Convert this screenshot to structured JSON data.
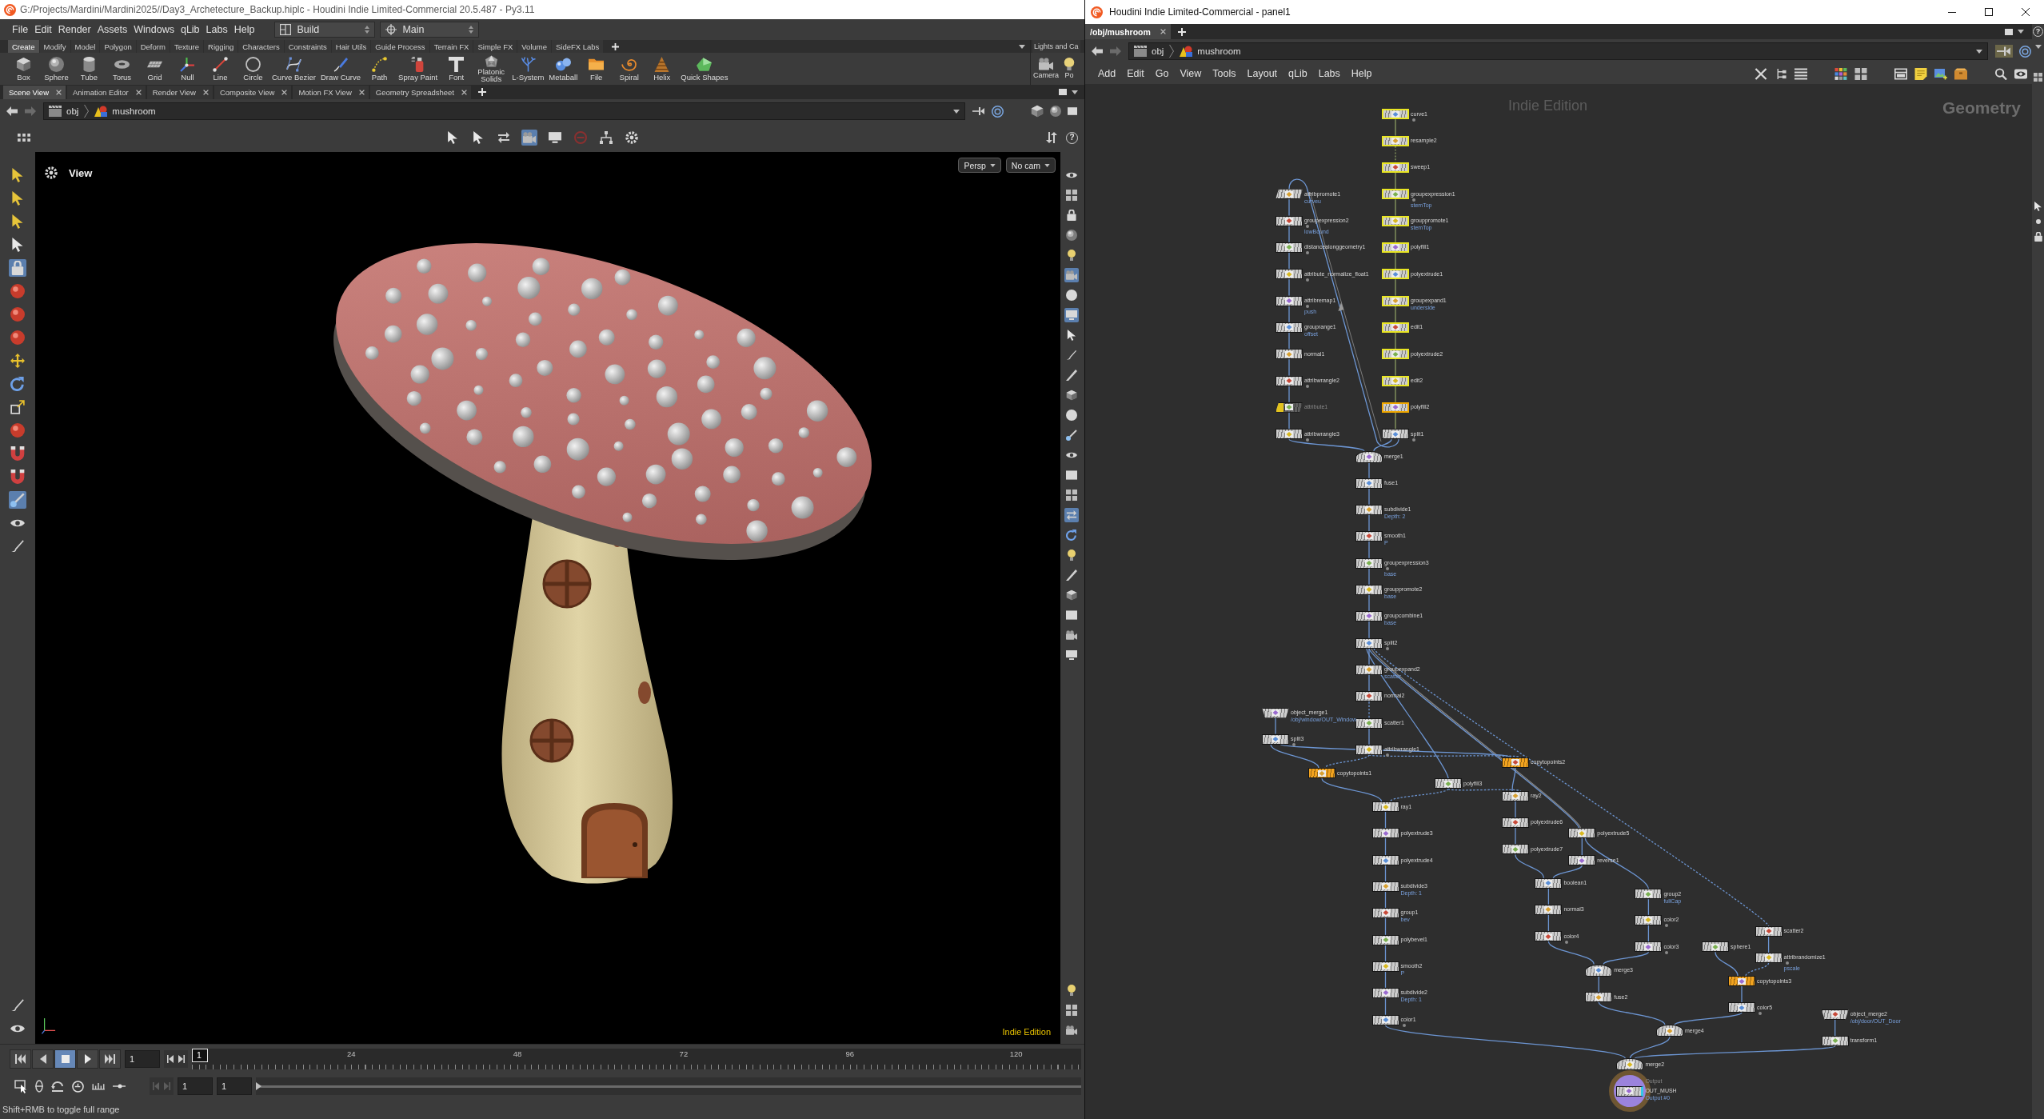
{
  "main_window": {
    "title": "G:/Projects/Mardini/Mardini2025//Day3_Archetecture_Backup.hiplc - Houdini Indie Limited-Commercial 20.5.487 - Py3.11",
    "menu": [
      "File",
      "Edit",
      "Render",
      "Assets",
      "Windows",
      "qLib",
      "Labs",
      "Help"
    ],
    "desktop": "Build",
    "workspace": "Main",
    "shelf_tabs": [
      {
        "label": "Create",
        "selected": true
      },
      {
        "label": "Modify",
        "selected": false
      },
      {
        "label": "Model",
        "selected": false
      },
      {
        "label": "Polygon",
        "selected": false
      },
      {
        "label": "Deform",
        "selected": false
      },
      {
        "label": "Texture",
        "selected": false
      },
      {
        "label": "Rigging",
        "selected": false
      },
      {
        "label": "Characters",
        "selected": false
      },
      {
        "label": "Constraints",
        "selected": false
      },
      {
        "label": "Hair Utils",
        "selected": false
      },
      {
        "label": "Guide Process",
        "selected": false
      },
      {
        "label": "Terrain FX",
        "selected": false
      },
      {
        "label": "Simple FX",
        "selected": false
      },
      {
        "label": "Volume",
        "selected": false
      },
      {
        "label": "SideFX Labs",
        "selected": false
      }
    ],
    "shelf_tools": [
      "Box",
      "Sphere",
      "Tube",
      "Torus",
      "Grid",
      "Null",
      "Line",
      "Circle",
      "Curve Bezier",
      "Draw Curve",
      "Path",
      "Spray Paint",
      "Font",
      "Platonic Solids",
      "L-System",
      "Metaball",
      "File",
      "Spiral",
      "Helix",
      "Quick Shapes"
    ],
    "side_shelf": {
      "tab": "Lights and Ca",
      "tools": [
        "Camera",
        "Po"
      ]
    },
    "pane_tabs": [
      {
        "label": "Scene View",
        "selected": true
      },
      {
        "label": "Animation Editor",
        "selected": false
      },
      {
        "label": "Render View",
        "selected": false
      },
      {
        "label": "Composite View",
        "selected": false
      },
      {
        "label": "Motion FX View",
        "selected": false
      },
      {
        "label": "Geometry Spreadsheet",
        "selected": false
      }
    ],
    "path": [
      "obj",
      "mushroom"
    ],
    "view_tools": [
      {
        "selected": false
      },
      {
        "selected": false
      },
      {
        "selected": false
      },
      {
        "selected": true
      },
      {
        "selected": false
      },
      {
        "selected": false
      },
      {
        "selected": false
      },
      {
        "selected": false
      }
    ],
    "view_help": "?",
    "left_tools": [
      {
        "selected": false
      },
      {
        "selected": false
      },
      {
        "selected": false
      },
      {
        "selected": false
      },
      {
        "selected": true
      },
      {
        "selected": false
      },
      {
        "selected": false
      },
      {
        "selected": false
      },
      {
        "selected": false
      },
      {
        "selected": false
      },
      {
        "selected": false
      },
      {
        "selected": false
      },
      {
        "selected": false
      },
      {
        "selected": false
      },
      {
        "selected": true
      },
      {
        "selected": false
      },
      {
        "selected": false
      },
      {
        "selected": false
      },
      {
        "selected": false
      }
    ],
    "viewport": {
      "title": "View",
      "menus": [
        "Persp",
        "No cam"
      ],
      "watermark": "Indie Edition"
    },
    "right_tools": [
      {
        "selected": false
      },
      {
        "selected": false
      },
      {
        "selected": false
      },
      {
        "selected": false
      },
      {
        "selected": false
      },
      {
        "selected": true
      },
      {
        "selected": false
      },
      {
        "selected": true
      },
      {
        "selected": false
      },
      {
        "selected": false
      },
      {
        "selected": false
      },
      {
        "selected": false
      },
      {
        "selected": false
      },
      {
        "selected": false
      },
      {
        "selected": false
      },
      {
        "selected": false
      },
      {
        "selected": false
      },
      {
        "selected": true
      },
      {
        "selected": false
      },
      {
        "selected": false
      },
      {
        "selected": false
      },
      {
        "selected": false
      },
      {
        "selected": false
      },
      {
        "selected": false
      },
      {
        "selected": false
      },
      {
        "selected": false
      },
      {
        "selected": false
      },
      {
        "selected": false
      }
    ],
    "timeline": {
      "playback": [
        {
          "selected": false
        },
        {
          "selected": false
        },
        {
          "selected": true
        },
        {
          "selected": false
        },
        {
          "selected": false
        }
      ],
      "frame": "1",
      "marker": "1",
      "ticks": [
        "24",
        "48",
        "72",
        "96",
        "120"
      ],
      "range_start": "1",
      "range_end": "1",
      "range_bar": {
        "level": 1
      }
    },
    "status_bar": "Shift+RMB to toggle full range"
  },
  "network_window": {
    "title": "Houdini Indie Limited-Commercial - panel1",
    "tabs": [
      {
        "label": "/obj/mushroom",
        "selected": true
      }
    ],
    "help": "?",
    "path": [
      "obj",
      "mushroom"
    ],
    "menu": [
      "Add",
      "Edit",
      "Go",
      "View",
      "Tools",
      "Layout",
      "qLib",
      "Labs",
      "Help"
    ],
    "watermark": "Indie Edition",
    "context": "Geometry",
    "nodes": [
      {
        "name": "curve1",
        "kind": "sop",
        "color": "#cccccc",
        "selected": true,
        "current": false,
        "bypassed": false,
        "dot": true
      },
      {
        "name": "resample2",
        "kind": "sop",
        "color": "#cccccc",
        "selected": true,
        "current": false,
        "bypassed": false,
        "dot": false
      },
      {
        "name": "sweep1",
        "kind": "sop",
        "color": "#cccccc",
        "selected": true,
        "current": false,
        "bypassed": false,
        "dot": false
      },
      {
        "name": "groupexpression1",
        "kind": "sop",
        "color": "#cccccc",
        "selected": true,
        "current": false,
        "bypassed": false,
        "dot": true,
        "note": "stemTop"
      },
      {
        "name": "grouppromote1",
        "kind": "sop",
        "color": "#cccccc",
        "selected": true,
        "current": false,
        "bypassed": false,
        "dot": false,
        "note": "stemTop"
      },
      {
        "name": "polyfill1",
        "kind": "sop",
        "color": "#cccccc",
        "selected": true,
        "current": false,
        "bypassed": false,
        "dot": false
      },
      {
        "name": "polyextrude1",
        "kind": "sop",
        "color": "#cccccc",
        "selected": true,
        "current": false,
        "bypassed": false,
        "dot": false
      },
      {
        "name": "groupexpand1",
        "kind": "sop",
        "color": "#cccccc",
        "selected": true,
        "current": false,
        "bypassed": false,
        "dot": false,
        "note": "underside"
      },
      {
        "name": "edit1",
        "kind": "sop",
        "color": "#cccccc",
        "selected": true,
        "current": false,
        "bypassed": false,
        "dot": false
      },
      {
        "name": "polyextrude2",
        "kind": "sop",
        "color": "#cccccc",
        "selected": true,
        "current": false,
        "bypassed": false,
        "dot": false
      },
      {
        "name": "edit2",
        "kind": "sop",
        "color": "#cccccc",
        "selected": true,
        "current": false,
        "bypassed": false,
        "dot": false
      },
      {
        "name": "polyfill2",
        "kind": "sop",
        "color": "#cccccc",
        "selected": true,
        "current": true,
        "bypassed": false,
        "dot": false
      },
      {
        "name": "split1",
        "kind": "sop",
        "color": "#cccccc",
        "selected": false,
        "current": false,
        "bypassed": false,
        "dot": true
      },
      {
        "name": "attribpromote1",
        "kind": "slanted",
        "color": "#cccccc",
        "selected": false,
        "current": false,
        "bypassed": false,
        "dot": false,
        "note": "curveu"
      },
      {
        "name": "groupexpression2",
        "kind": "sop",
        "color": "#cccccc",
        "selected": false,
        "current": false,
        "bypassed": false,
        "dot": true,
        "note": "lowBound"
      },
      {
        "name": "distancealonggeometry1",
        "kind": "sop",
        "color": "#cccccc",
        "selected": false,
        "current": false,
        "bypassed": false,
        "dot": true
      },
      {
        "name": "attribute_normalize_float1",
        "kind": "sop",
        "color": "#cccccc",
        "selected": false,
        "current": false,
        "bypassed": false,
        "dot": true
      },
      {
        "name": "attribremap1",
        "kind": "sop",
        "color": "#cccccc",
        "selected": false,
        "current": false,
        "bypassed": false,
        "dot": true,
        "note": "push"
      },
      {
        "name": "grouprange1",
        "kind": "sop",
        "color": "#cccccc",
        "selected": false,
        "current": false,
        "bypassed": false,
        "dot": false,
        "note": "offset"
      },
      {
        "name": "normal1",
        "kind": "sop",
        "color": "#cccccc",
        "selected": false,
        "current": false,
        "bypassed": false,
        "dot": false
      },
      {
        "name": "attribwrangle2",
        "kind": "sop",
        "color": "#cccccc",
        "selected": false,
        "current": false,
        "bypassed": false,
        "dot": true
      },
      {
        "name": "attribute1",
        "kind": "slanted",
        "color": "#5e5e5e",
        "selected": false,
        "current": false,
        "bypassed": true,
        "dot": false
      },
      {
        "name": "attribwrangle3",
        "kind": "sop",
        "color": "#cccccc",
        "selected": false,
        "current": false,
        "bypassed": false,
        "dot": true
      },
      {
        "name": "merge1",
        "kind": "merge",
        "color": "#cccccc",
        "selected": false,
        "current": false,
        "bypassed": false,
        "dot": false
      },
      {
        "name": "fuse1",
        "kind": "sop",
        "color": "#cccccc",
        "selected": false,
        "current": false,
        "bypassed": false,
        "dot": false
      },
      {
        "name": "subdivide1",
        "kind": "sop",
        "color": "#cccccc",
        "selected": false,
        "current": false,
        "bypassed": false,
        "dot": false,
        "note": "Depth: 2"
      },
      {
        "name": "smooth1",
        "kind": "sop",
        "color": "#cccccc",
        "selected": false,
        "current": false,
        "bypassed": false,
        "dot": false,
        "note": "P"
      },
      {
        "name": "groupexpression3",
        "kind": "sop",
        "color": "#cccccc",
        "selected": false,
        "current": false,
        "bypassed": false,
        "dot": true,
        "note": "base"
      },
      {
        "name": "grouppromote2",
        "kind": "sop",
        "color": "#cccccc",
        "selected": false,
        "current": false,
        "bypassed": false,
        "dot": false,
        "note": "base"
      },
      {
        "name": "groupcombine1",
        "kind": "sop",
        "color": "#cccccc",
        "selected": false,
        "current": false,
        "bypassed": false,
        "dot": false,
        "note": "base"
      },
      {
        "name": "split2",
        "kind": "sop",
        "color": "#cccccc",
        "selected": false,
        "current": false,
        "bypassed": false,
        "dot": true
      },
      {
        "name": "groupexpand2",
        "kind": "sop",
        "color": "#cccccc",
        "selected": false,
        "current": false,
        "bypassed": false,
        "dot": false,
        "note": "scatter"
      },
      {
        "name": "normal2",
        "kind": "sop",
        "color": "#cccccc",
        "selected": false,
        "current": false,
        "bypassed": false,
        "dot": false
      },
      {
        "name": "scatter1",
        "kind": "sop",
        "color": "#cccccc",
        "selected": false,
        "current": false,
        "bypassed": false,
        "dot": false
      },
      {
        "name": "attribwrangle1",
        "kind": "sop",
        "color": "#cccccc",
        "selected": false,
        "current": false,
        "bypassed": false,
        "dot": true
      },
      {
        "name": "object_merge1",
        "kind": "object_merge",
        "color": "#cccccc",
        "selected": false,
        "current": false,
        "bypassed": false,
        "dot": false,
        "note": "/obj/window/OUT_Window"
      },
      {
        "name": "split3",
        "kind": "sop",
        "color": "#cccccc",
        "selected": false,
        "current": false,
        "bypassed": false,
        "dot": true
      },
      {
        "name": "copytopoints1",
        "kind": "sop",
        "color": "#f2a31f",
        "selected": false,
        "current": false,
        "bypassed": false,
        "dot": false
      },
      {
        "name": "copytopoints2",
        "kind": "sop",
        "color": "#f2a31f",
        "selected": false,
        "current": false,
        "bypassed": false,
        "dot": false
      },
      {
        "name": "polyfill3",
        "kind": "sop",
        "color": "#cccccc",
        "selected": false,
        "current": false,
        "bypassed": false,
        "dot": false
      },
      {
        "name": "ray1",
        "kind": "sop",
        "color": "#cccccc",
        "selected": false,
        "current": false,
        "bypassed": false,
        "dot": false
      },
      {
        "name": "polyextrude3",
        "kind": "sop",
        "color": "#cccccc",
        "selected": false,
        "current": false,
        "bypassed": false,
        "dot": false
      },
      {
        "name": "polyextrude4",
        "kind": "sop",
        "color": "#cccccc",
        "selected": false,
        "current": false,
        "bypassed": false,
        "dot": false
      },
      {
        "name": "subdivide3",
        "kind": "sop",
        "color": "#cccccc",
        "selected": false,
        "current": false,
        "bypassed": false,
        "dot": false,
        "note": "Depth: 1"
      },
      {
        "name": "group1",
        "kind": "sop",
        "color": "#cccccc",
        "selected": false,
        "current": false,
        "bypassed": false,
        "dot": false,
        "note": "bev"
      },
      {
        "name": "polybevel1",
        "kind": "sop",
        "color": "#cccccc",
        "selected": false,
        "current": false,
        "bypassed": false,
        "dot": false
      },
      {
        "name": "smooth2",
        "kind": "sop",
        "color": "#cccccc",
        "selected": false,
        "current": false,
        "bypassed": false,
        "dot": false,
        "note": "P"
      },
      {
        "name": "subdivide2",
        "kind": "sop",
        "color": "#cccccc",
        "selected": false,
        "current": false,
        "bypassed": false,
        "dot": false,
        "note": "Depth: 1"
      },
      {
        "name": "color1",
        "kind": "sop",
        "color": "#cccccc",
        "selected": false,
        "current": false,
        "bypassed": false,
        "dot": true
      },
      {
        "name": "ray2",
        "kind": "sop",
        "color": "#cccccc",
        "selected": false,
        "current": false,
        "bypassed": false,
        "dot": false
      },
      {
        "name": "polyextrude6",
        "kind": "sop",
        "color": "#cccccc",
        "selected": false,
        "current": false,
        "bypassed": false,
        "dot": false
      },
      {
        "name": "polyextrude7",
        "kind": "sop",
        "color": "#cccccc",
        "selected": false,
        "current": false,
        "bypassed": false,
        "dot": false
      },
      {
        "name": "polyextrude5",
        "kind": "sop",
        "color": "#cccccc",
        "selected": false,
        "current": false,
        "bypassed": false,
        "dot": false
      },
      {
        "name": "reverse1",
        "kind": "sop",
        "color": "#cccccc",
        "selected": false,
        "current": false,
        "bypassed": false,
        "dot": false
      },
      {
        "name": "boolean1",
        "kind": "sop",
        "color": "#cccccc",
        "selected": false,
        "current": false,
        "bypassed": false,
        "dot": false
      },
      {
        "name": "normal3",
        "kind": "sop",
        "color": "#cccccc",
        "selected": false,
        "current": false,
        "bypassed": false,
        "dot": false
      },
      {
        "name": "color4",
        "kind": "sop",
        "color": "#cccccc",
        "selected": false,
        "current": false,
        "bypassed": false,
        "dot": true
      },
      {
        "name": "group2",
        "kind": "sop",
        "color": "#cccccc",
        "selected": false,
        "current": false,
        "bypassed": false,
        "dot": false,
        "note": "fullCap"
      },
      {
        "name": "color2",
        "kind": "sop",
        "color": "#cccccc",
        "selected": false,
        "current": false,
        "bypassed": false,
        "dot": true
      },
      {
        "name": "color3",
        "kind": "sop",
        "color": "#cccccc",
        "selected": false,
        "current": false,
        "bypassed": false,
        "dot": true
      },
      {
        "name": "merge3",
        "kind": "merge",
        "color": "#cccccc",
        "selected": false,
        "current": false,
        "bypassed": false,
        "dot": false
      },
      {
        "name": "fuse2",
        "kind": "sop",
        "color": "#cccccc",
        "selected": false,
        "current": false,
        "bypassed": false,
        "dot": false
      },
      {
        "name": "scatter2",
        "kind": "sop",
        "color": "#cccccc",
        "selected": false,
        "current": false,
        "bypassed": false,
        "dot": false
      },
      {
        "name": "sphere1",
        "kind": "sop",
        "color": "#cccccc",
        "selected": false,
        "current": false,
        "bypassed": false,
        "dot": false
      },
      {
        "name": "attribrandomize1",
        "kind": "sop",
        "color": "#cccccc",
        "selected": false,
        "current": false,
        "bypassed": false,
        "dot": true,
        "note": "pscale"
      },
      {
        "name": "copytopoints3",
        "kind": "sop",
        "color": "#f2a31f",
        "selected": false,
        "current": false,
        "bypassed": false,
        "dot": false
      },
      {
        "name": "color5",
        "kind": "sop",
        "color": "#cccccc",
        "selected": false,
        "current": false,
        "bypassed": false,
        "dot": true
      },
      {
        "name": "merge4",
        "kind": "merge",
        "color": "#cccccc",
        "selected": false,
        "current": false,
        "bypassed": false,
        "dot": false
      },
      {
        "name": "object_merge2",
        "kind": "object_merge",
        "color": "#cccccc",
        "selected": false,
        "current": false,
        "bypassed": false,
        "dot": false,
        "note": "/obj/door/OUT_Door"
      },
      {
        "name": "transform1",
        "kind": "sop",
        "color": "#cccccc",
        "selected": false,
        "current": false,
        "bypassed": false,
        "dot": false
      },
      {
        "name": "merge2",
        "kind": "merge",
        "color": "#cccccc",
        "selected": false,
        "current": false,
        "bypassed": false,
        "dot": false
      },
      {
        "name": "OUT_MUSH",
        "kind": "output",
        "color": "#cccccc",
        "selected": false,
        "current": false,
        "bypassed": false,
        "dot": false,
        "caption": "Output",
        "note": "Output #0"
      }
    ]
  }
}
